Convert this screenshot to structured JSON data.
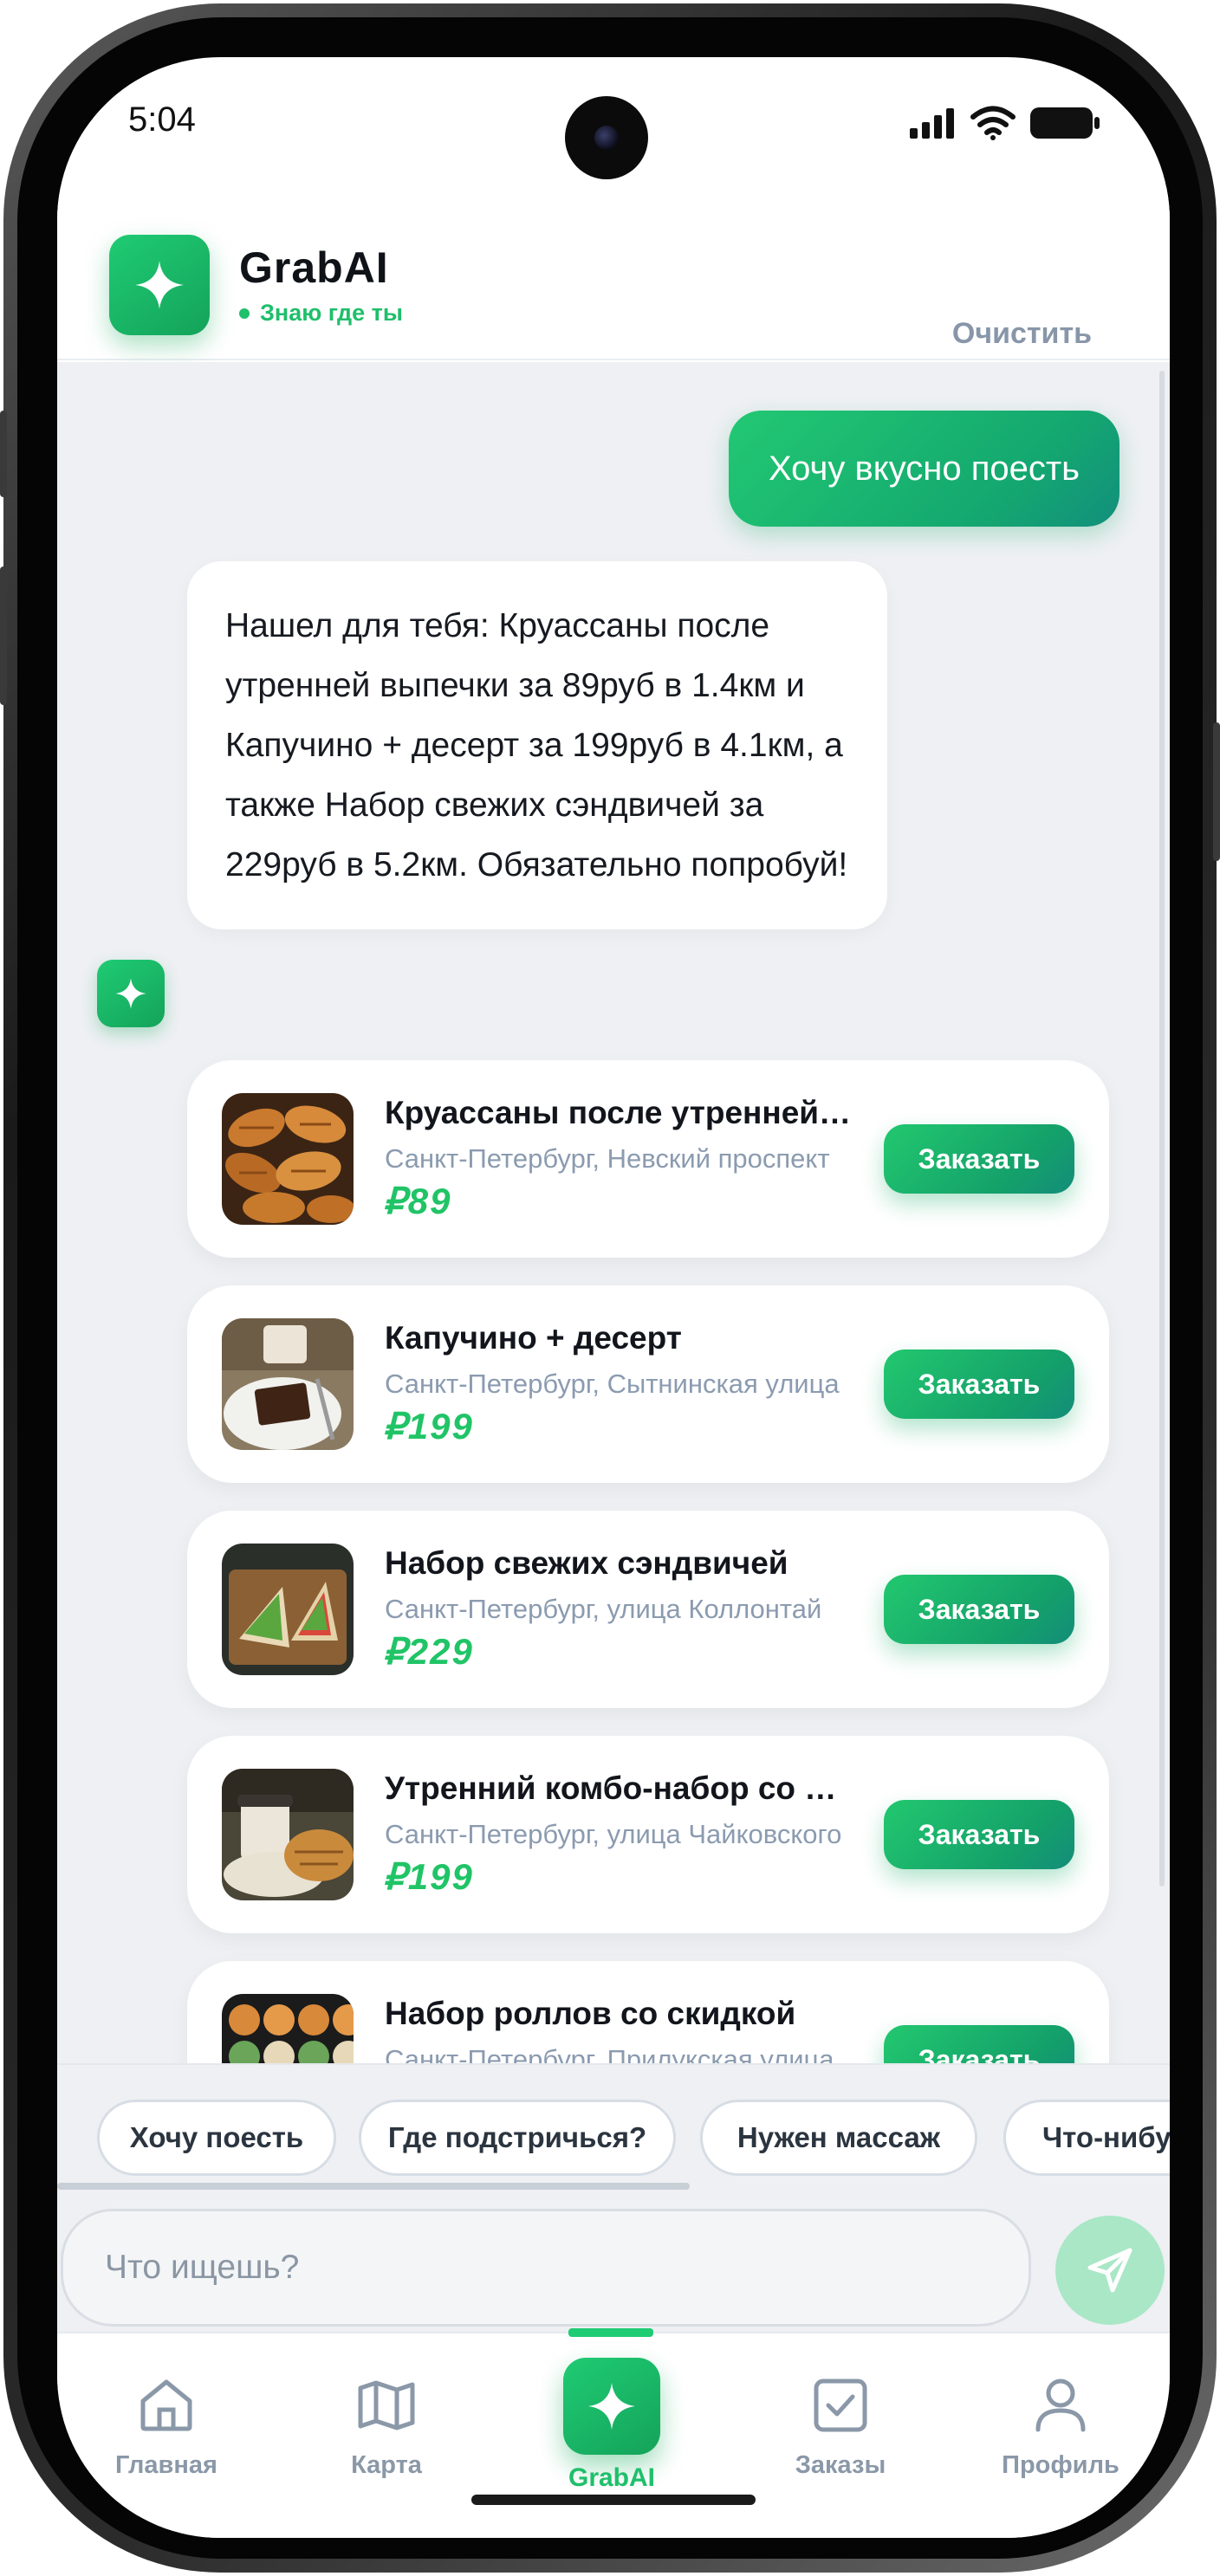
{
  "status_bar": {
    "time": "5:04"
  },
  "header": {
    "brand": "GrabAI",
    "status": "Знаю где ты",
    "clear_label": "Очистить"
  },
  "chat": {
    "user_message": "Хочу вкусно поесть",
    "bot_message": "Нашел для тебя: Круассаны после утренней выпечки за 89руб в 1.4км и Капучино + десерт за 199руб в 4.1км, а также Набор свежих сэндвичей за 229руб в 5.2км. Обязательно попробуй!",
    "offers": [
      {
        "title": "Круассаны после утренней выпечки",
        "address": "Санкт-Петербург, Невский проспект",
        "price": "₽89",
        "button": "Заказать",
        "image": "croissants-photo"
      },
      {
        "title": "Капучино + десерт",
        "address": "Санкт-Петербург, Сытнинская улица",
        "price": "₽199",
        "button": "Заказать",
        "image": "coffee-cake-photo"
      },
      {
        "title": "Набор свежих сэндвичей",
        "address": "Санкт-Петербург, улица Коллонтай",
        "price": "₽229",
        "button": "Заказать",
        "image": "sandwiches-photo"
      },
      {
        "title": "Утренний комбо-набор со скидкой",
        "address": "Санкт-Петербург, улица Чайковского",
        "price": "₽199",
        "button": "Заказать",
        "image": "coffee-croissant-photo"
      },
      {
        "title": "Набор роллов со скидкой",
        "address": "Санкт-Петербург, Прилукская улица",
        "price": "",
        "button": "Заказать",
        "image": "sushi-rolls-photo"
      }
    ]
  },
  "quick_replies": [
    "Хочу поесть",
    "Где подстричься?",
    "Нужен массаж",
    "Что-нибудь"
  ],
  "input": {
    "placeholder": "Что ищешь?"
  },
  "nav": {
    "items": [
      {
        "label": "Главная",
        "icon": "home-icon"
      },
      {
        "label": "Карта",
        "icon": "map-icon"
      },
      {
        "label": "GrabAI",
        "icon": "sparkle-icon"
      },
      {
        "label": "Заказы",
        "icon": "orders-check-icon"
      },
      {
        "label": "Профиль",
        "icon": "profile-icon"
      }
    ]
  },
  "colors": {
    "accent": "#1fcb73",
    "muted": "#8a98a8",
    "chat_bg": "#eef0f3"
  }
}
